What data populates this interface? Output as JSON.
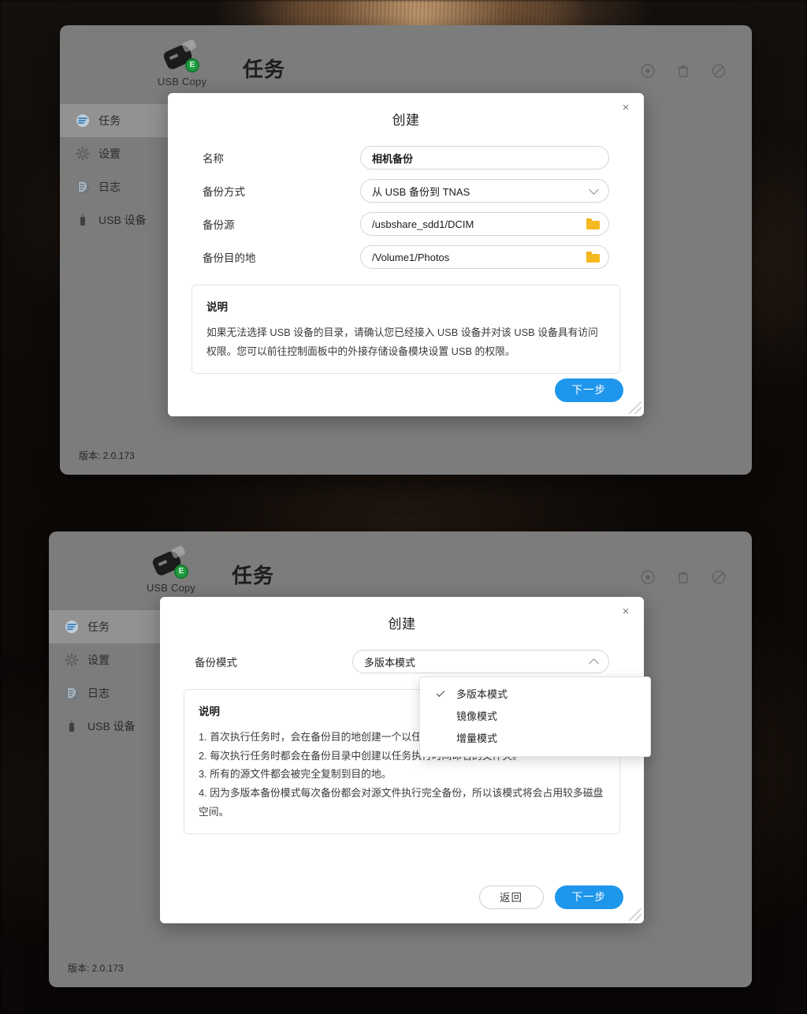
{
  "app": {
    "logo_label": "USB Copy",
    "logo_icon": "usb-drive-icon",
    "badge_letter": "E",
    "page_title": "任务",
    "version": "版本: 2.0.173",
    "toolbar": [
      {
        "name": "run-task-icon",
        "title": "run"
      },
      {
        "name": "delete-task-icon",
        "title": "delete"
      },
      {
        "name": "disable-task-icon",
        "title": "disable"
      }
    ],
    "sidebar": [
      {
        "label": "任务",
        "icon": "task-list-icon",
        "active": true
      },
      {
        "label": "设置",
        "icon": "gear-icon",
        "active": false
      },
      {
        "label": "日志",
        "icon": "log-document-icon",
        "active": false
      },
      {
        "label": "USB 设备",
        "icon": "usb-device-icon",
        "active": false
      }
    ]
  },
  "dialog_step1": {
    "title": "创建",
    "close_icon": "close-icon",
    "fields": [
      {
        "label": "名称",
        "value": "相机备份",
        "control": "text"
      },
      {
        "label": "备份方式",
        "value": "从 USB 备份到 TNAS",
        "control": "select"
      },
      {
        "label": "备份源",
        "value": "/usbshare_sdd1/DCIM",
        "control": "folder-picker"
      },
      {
        "label": "备份目的地",
        "value": "/Volume1/Photos",
        "control": "folder-picker"
      }
    ],
    "note": {
      "title": "说明",
      "text": "如果无法选择 USB 设备的目录，请确认您已经接入 USB 设备并对该 USB 设备具有访问权限。您可以前往控制面板中的外接存储设备模块设置 USB 的权限。"
    },
    "primary_button": "下一步"
  },
  "dialog_step2": {
    "title": "创建",
    "close_icon": "close-icon",
    "field": {
      "label": "备份模式",
      "value": "多版本模式",
      "control": "select"
    },
    "dropdown": {
      "expanded": true,
      "selected": "多版本模式",
      "options": [
        "多版本模式",
        "镜像模式",
        "增量模式"
      ]
    },
    "note": {
      "title": "说明",
      "lines": [
        "1. 首次执行任务时，会在备份目的地创建一个以任务名称命名的目录。",
        "2. 每次执行任务时都会在备份目录中创建以任务执行时间命名的文件夹。",
        "3. 所有的源文件都会被完全复制到目的地。",
        "4. 因为多版本备份模式每次备份都会对源文件执行完全备份，所以该模式将会占用较多磁盘空间。"
      ]
    },
    "secondary_button": "返回",
    "primary_button": "下一步"
  },
  "colors": {
    "accent": "#1e96ec",
    "window_chrome": "#7c7c7c",
    "folder_yellow": "#f5b921",
    "badge_green": "#1f9d3f"
  }
}
